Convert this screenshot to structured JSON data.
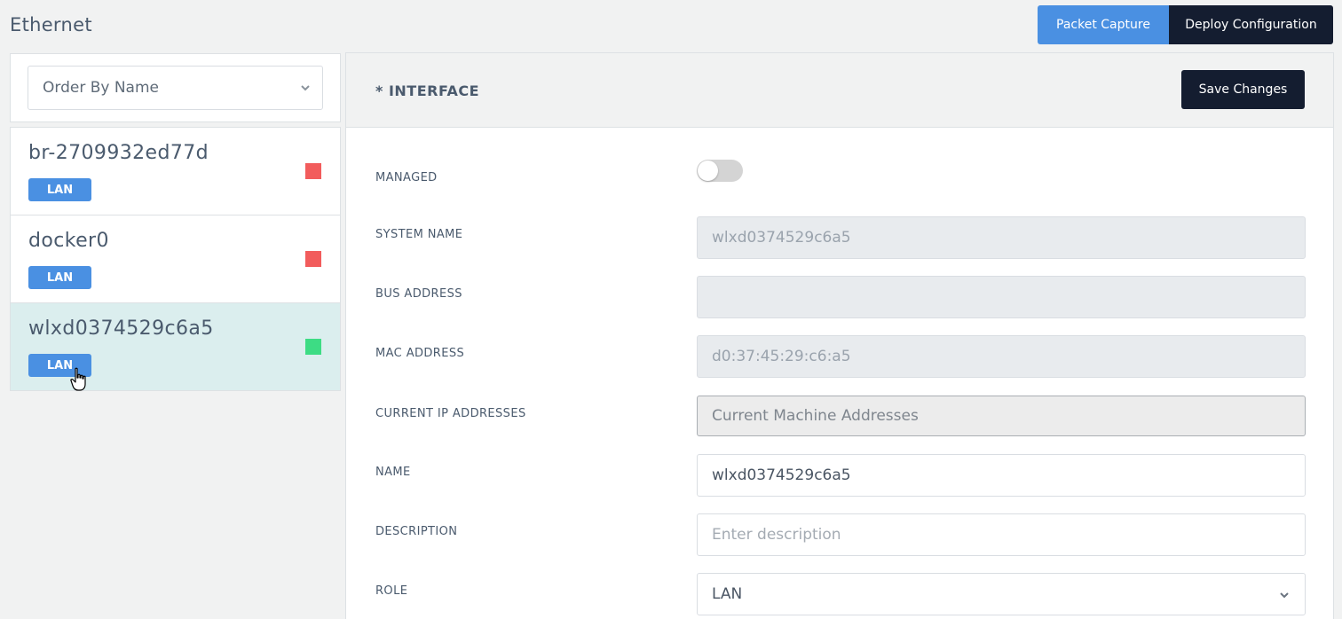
{
  "page": {
    "title": "Ethernet"
  },
  "toolbar": {
    "packet_capture": "Packet Capture",
    "deploy_configuration": "Deploy Configuration"
  },
  "sidebar": {
    "order_select": "Order By Name",
    "interfaces": [
      {
        "name": "br-2709932ed77d",
        "badge": "LAN",
        "status_color": "#f25c5c",
        "selected": false
      },
      {
        "name": "docker0",
        "badge": "LAN",
        "status_color": "#f25c5c",
        "selected": false
      },
      {
        "name": "wlxd0374529c6a5",
        "badge": "LAN",
        "status_color": "#3ddc84",
        "selected": true
      }
    ]
  },
  "panel": {
    "title": "* INTERFACE",
    "save_label": "Save Changes",
    "fields": {
      "managed": {
        "label": "MANAGED",
        "on": false
      },
      "system_name": {
        "label": "SYSTEM NAME",
        "value": "wlxd0374529c6a5"
      },
      "bus_address": {
        "label": "BUS ADDRESS",
        "value": ""
      },
      "mac_address": {
        "label": "MAC ADDRESS",
        "value": "d0:37:45:29:c6:a5"
      },
      "current_ip": {
        "label": "CURRENT IP ADDRESSES",
        "value": "Current Machine Addresses"
      },
      "name": {
        "label": "NAME",
        "value": "wlxd0374529c6a5"
      },
      "description": {
        "label": "DESCRIPTION",
        "placeholder": "Enter description"
      },
      "role": {
        "label": "ROLE",
        "value": "LAN"
      }
    }
  },
  "colors": {
    "accent": "#4a90e2",
    "dark": "#141d30",
    "selected_bg": "#dbeeee"
  }
}
